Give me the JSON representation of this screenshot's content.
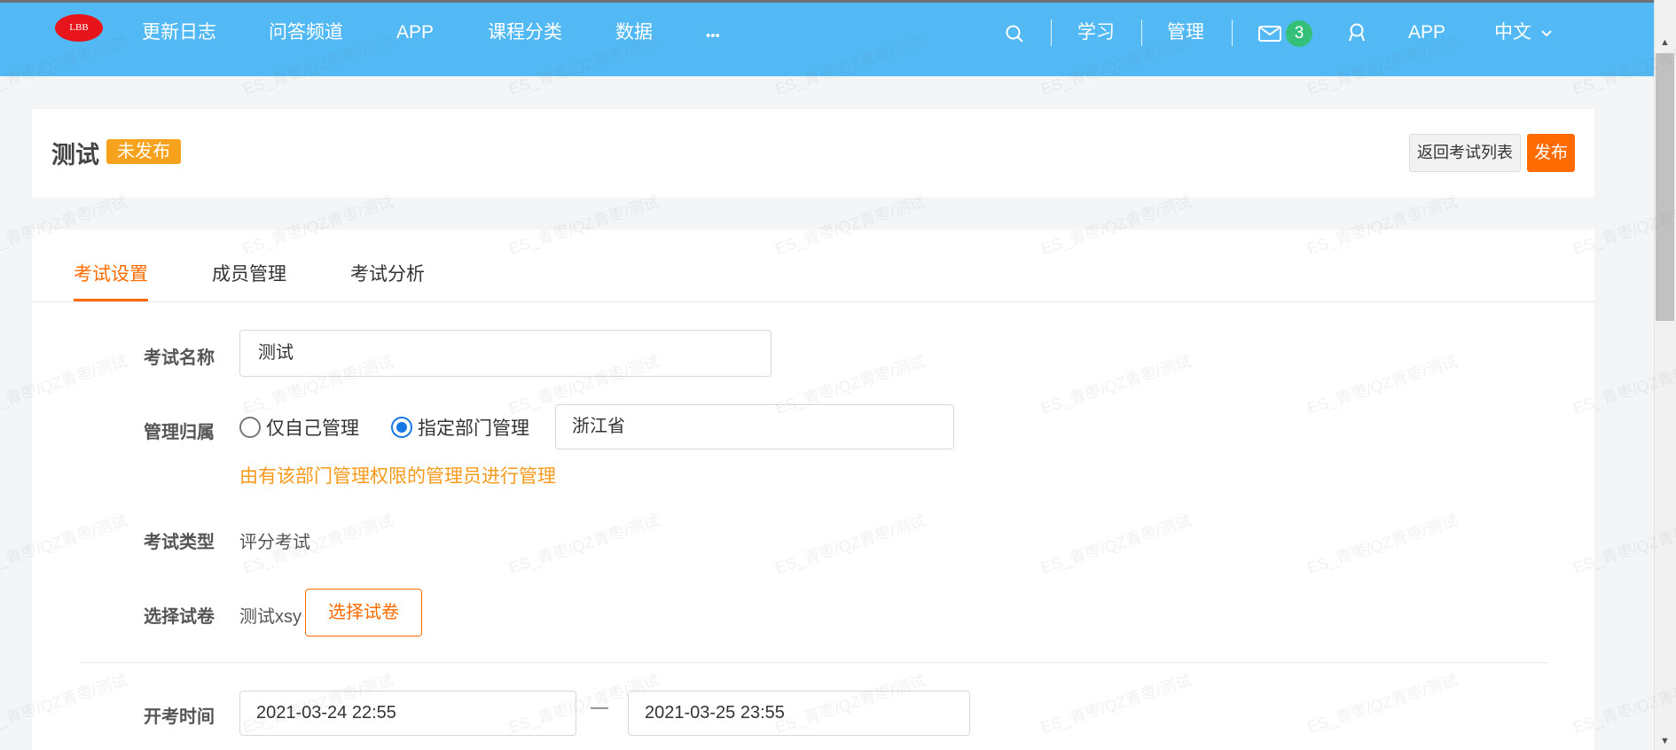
{
  "nav": {
    "logo_text": "LBB",
    "items": [
      "更新日志",
      "问答频道",
      "APP",
      "课程分类",
      "数据",
      "•••"
    ],
    "right": {
      "study": "学习",
      "manage": "管理",
      "message_count": "3",
      "app": "APP",
      "language": "中文"
    },
    "icons": [
      "search-icon",
      "mail-icon",
      "user-icon",
      "chevron-down-icon"
    ]
  },
  "header": {
    "title": "测试",
    "status": "未发布",
    "back_button": "返回考试列表",
    "publish_button": "发布"
  },
  "tabs": [
    {
      "label": "考试设置",
      "active": true
    },
    {
      "label": "成员管理",
      "active": false
    },
    {
      "label": "考试分析",
      "active": false
    }
  ],
  "form": {
    "name_label": "考试名称",
    "name_value": "测试",
    "owner_label": "管理归属",
    "owner_options": [
      "仅自己管理",
      "指定部门管理"
    ],
    "owner_selected": "指定部门管理",
    "department_value": "浙江省",
    "owner_hint": "由有该部门管理权限的管理员进行管理",
    "type_label": "考试类型",
    "type_value": "评分考试",
    "paper_label": "选择试卷",
    "paper_value": "测试xsy",
    "paper_button": "选择试卷",
    "time_label": "开考时间",
    "time_start": "2021-03-24 22:55",
    "time_separator": "—",
    "time_end": "2021-03-25 23:55"
  },
  "colors": {
    "nav_bg": "#52b9f5",
    "accent": "#ff6b00",
    "status_badge": "#f7a21c",
    "message_badge": "#35c07a",
    "radio_checked": "#1677e5"
  },
  "watermark": "ES_青枣/QZ青枣/测试"
}
